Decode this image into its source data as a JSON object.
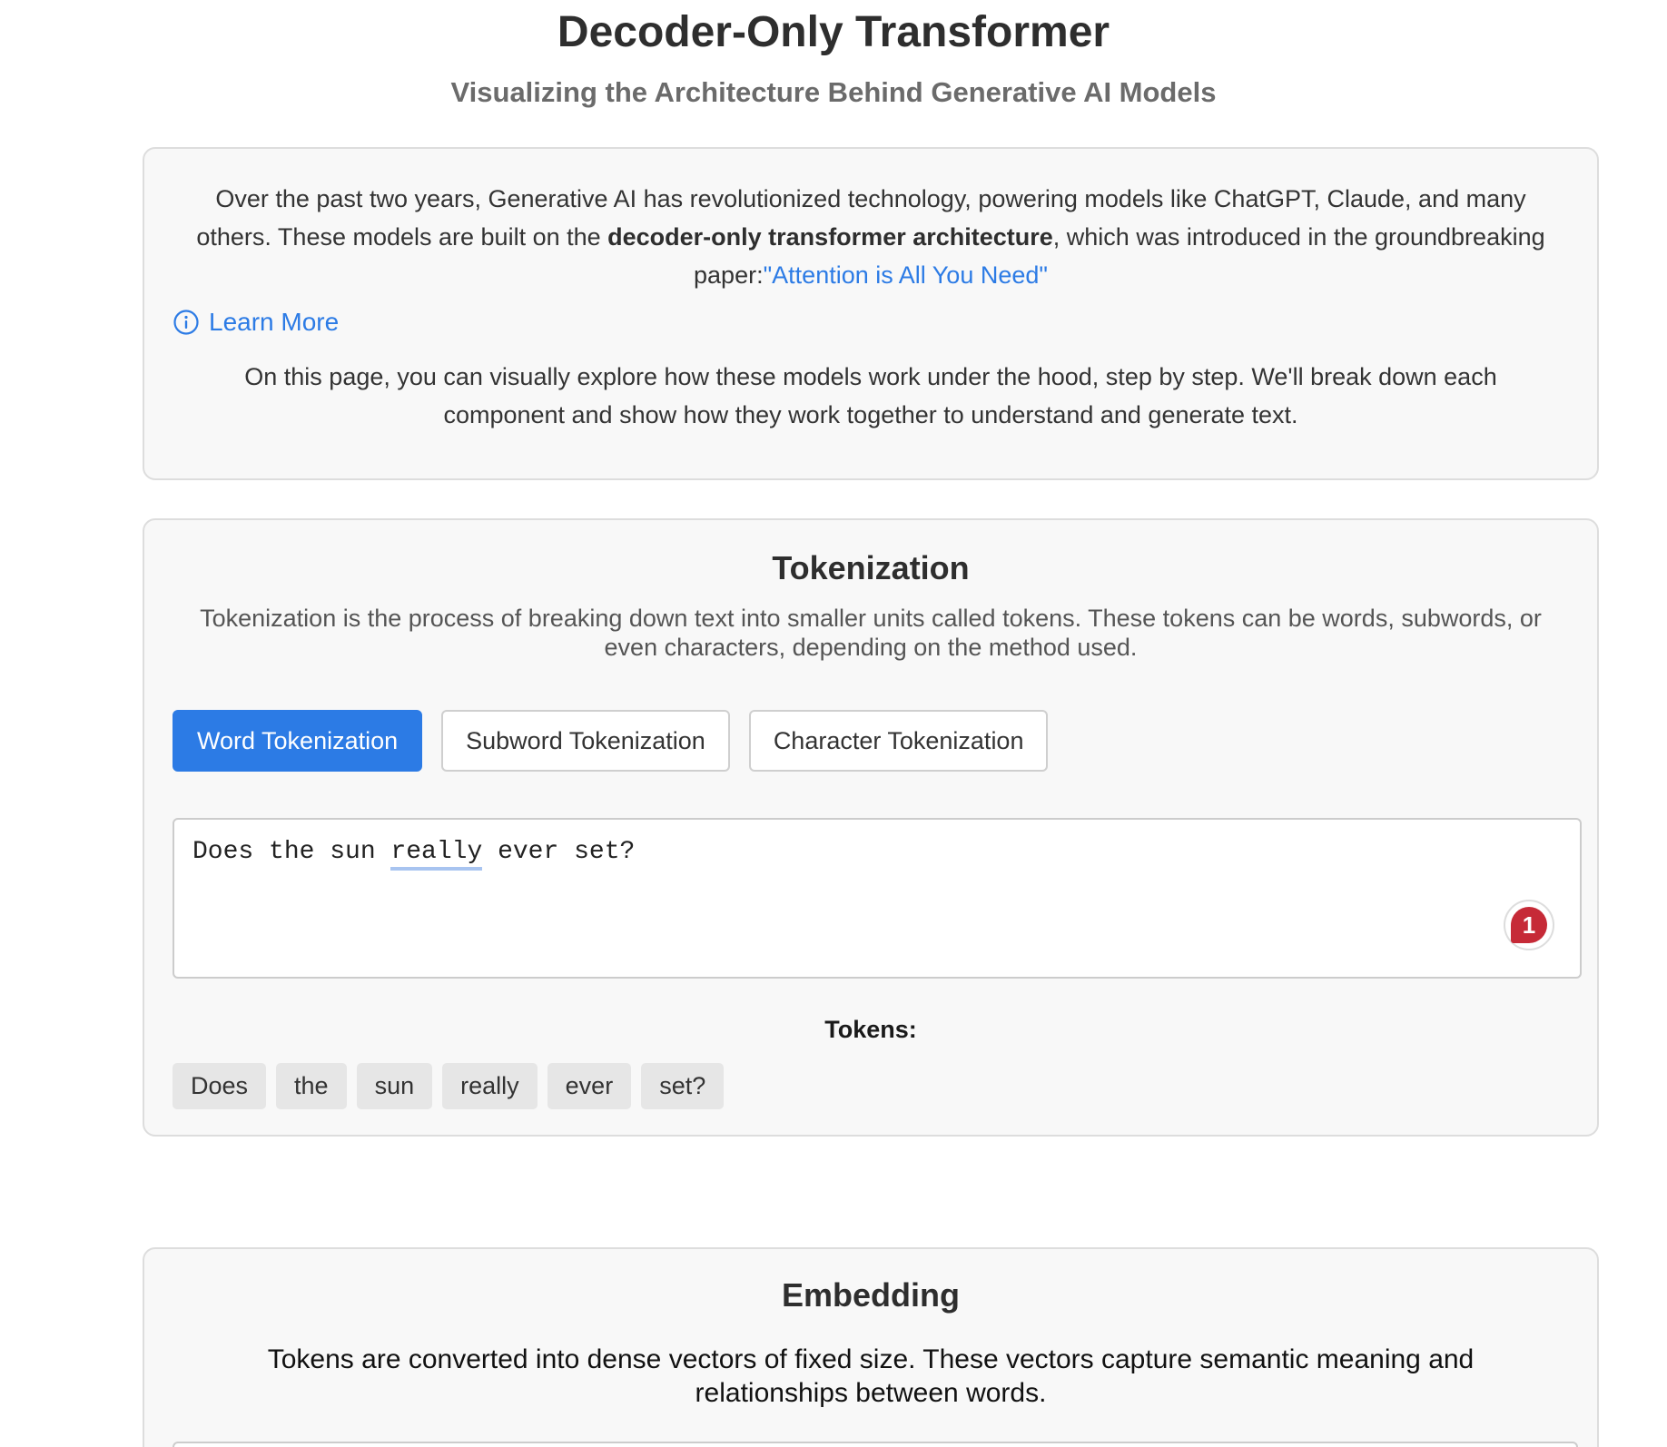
{
  "header": {
    "title": "Decoder-Only Transformer",
    "subtitle": "Visualizing the Architecture Behind Generative AI Models"
  },
  "intro": {
    "p1_before": "Over the past two years, Generative AI has revolutionized technology, powering models like ChatGPT, Claude, and many others. These models are built on the ",
    "p1_bold": "decoder-only transformer architecture",
    "p1_middle": ", which was introduced in the groundbreaking paper:",
    "paper_link": "\"Attention is All You Need\"",
    "learn_more_label": "Learn More",
    "learn_more_icon": "info-circle-icon",
    "p2": "On this page, you can visually explore how these models work under the hood, step by step. We'll break down each component and show how they work together to understand and generate text."
  },
  "tokenization": {
    "title": "Tokenization",
    "description": "Tokenization is the process of breaking down text into smaller units called tokens. These tokens can be words, subwords, or even characters, depending on the method used.",
    "tabs": [
      {
        "label": "Word Tokenization",
        "active": true
      },
      {
        "label": "Subword Tokenization",
        "active": false
      },
      {
        "label": "Character Tokenization",
        "active": false
      }
    ],
    "input": {
      "before": "Does the sun ",
      "flagged_word": "really",
      "after": " ever set?",
      "issue_count": "1"
    },
    "tokens_label": "Tokens:",
    "tokens": [
      "Does",
      "the",
      "sun",
      "really",
      "ever",
      "set?"
    ]
  },
  "embedding": {
    "title": "Embedding",
    "description": "Tokens are converted into dense vectors of fixed size. These vectors capture semantic meaning and relationships between words."
  },
  "colors": {
    "accent": "#2c7be5",
    "badge": "#c62a37",
    "card_bg": "#f8f8f8",
    "token_bg": "#e6e6e6"
  }
}
